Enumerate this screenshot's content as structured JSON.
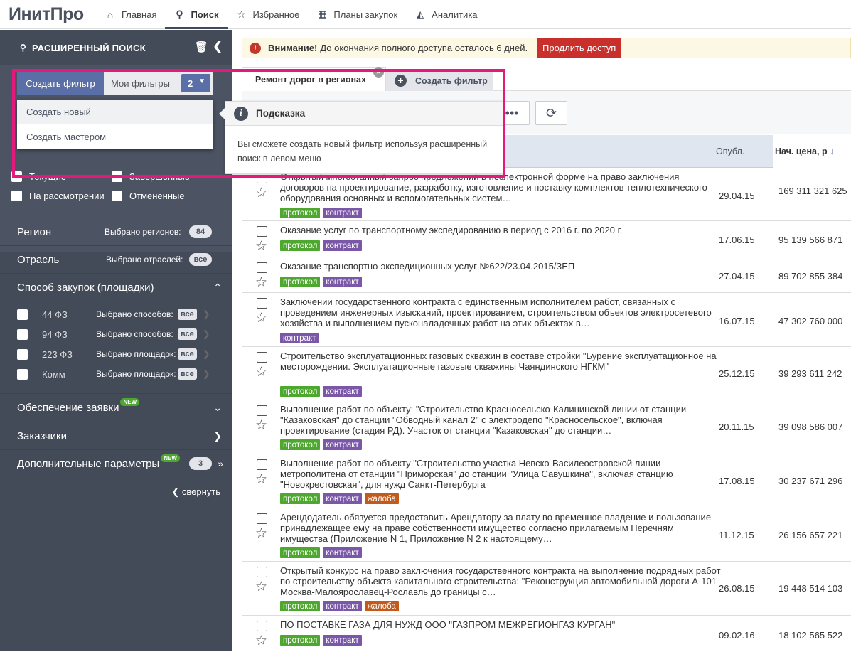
{
  "app": {
    "logo": "ИнитПро"
  },
  "nav": [
    {
      "label": "Главная",
      "icon": "home-icon",
      "glyph": "⌂"
    },
    {
      "label": "Поиск",
      "icon": "search-icon",
      "glyph": "⚲"
    },
    {
      "label": "Избранное",
      "icon": "star-icon",
      "glyph": "☆"
    },
    {
      "label": "Планы закупок",
      "icon": "calendar-icon",
      "glyph": "▦"
    },
    {
      "label": "Аналитика",
      "icon": "chart-icon",
      "glyph": "◭"
    }
  ],
  "sidebar": {
    "title": "РАСШИРЕННЫЙ ПОИСК",
    "filter_tabs": {
      "create": "Создать фильтр",
      "my": "Мои фильтры",
      "my_count": "2"
    },
    "dropdown": [
      "Создать новый",
      "Создать мастером"
    ],
    "status_checks": [
      "Текущие",
      "Завершенные",
      "На рассмотрении",
      "Отмененные"
    ],
    "region": {
      "label": "Регион",
      "meta": "Выбрано регионов:",
      "value": "84"
    },
    "industry": {
      "label": "Отрасль",
      "meta": "Выбрано отраслей:",
      "value": "все"
    },
    "method": {
      "label": "Способ закупок (площадки)"
    },
    "methods": [
      {
        "label": "44 ФЗ",
        "meta": "Выбрано способов:",
        "value": "все"
      },
      {
        "label": "94 ФЗ",
        "meta": "Выбрано способов:",
        "value": "все"
      },
      {
        "label": "223 ФЗ",
        "meta": "Выбрано площадок:",
        "value": "все"
      },
      {
        "label": "Комм",
        "meta": "Выбрано площадок:",
        "value": "все"
      }
    ],
    "security": {
      "label": "Обеспечение заявки",
      "badge": "NEW"
    },
    "customers": {
      "label": "Заказчики"
    },
    "extra": {
      "label": "Дополнительные параметры",
      "badge": "NEW",
      "count": "3"
    },
    "collapse": "свернуть"
  },
  "alert": {
    "strong": "Внимание!",
    "text": "До окончания полного доступа осталось 6 дней.",
    "button": "Продлить доступ"
  },
  "result_tabs": {
    "active": "Ремонт дорог в регионах",
    "add": "Создать фильтр"
  },
  "tooltip": {
    "title": "Подсказка",
    "body": "Вы сможете создать новый фильтр используя расширенный поиск в левом меню"
  },
  "table": {
    "headers": {
      "published": "Опубл.",
      "price": "Нач. цена, р"
    },
    "rows": [
      {
        "title": "Открытый многоэтапный запрос предложений в неэлектронной форме на право заключения договоров на проектирование, разработку, изготовление и поставку комплектов теплотехнического оборудования основных и вспомогательных систем…",
        "tags": [
          "протокол",
          "контракт"
        ],
        "date": "29.04.15",
        "price": "169 311 321 625"
      },
      {
        "title": "Оказание услуг по транспортному экспедированию в период с 2016 г. по 2020 г.",
        "tags": [
          "протокол",
          "контракт"
        ],
        "date": "17.06.15",
        "price": "95 139 566 871"
      },
      {
        "title": "Оказание транспортно-экспедиционных услуг №622/23.04.2015/ЗЕП",
        "tags": [
          "протокол",
          "контракт"
        ],
        "date": "27.04.15",
        "price": "89 702 855 384"
      },
      {
        "title": "Заключении государственного контракта с единственным исполнителем работ, связанных с проведением инженерных изысканий, проектированием, строительством объектов электросетевого хозяйства и выполнением пусконаладочных работ на этих объектах в…",
        "tags": [
          "контракт"
        ],
        "date": "16.07.15",
        "price": "47 302 760 000"
      },
      {
        "title": "Строительство эксплуатационных газовых скважин в составе стройки \"Бурение эксплуатационное на месторождении. Эксплуатационные газовые скважины Чаяндинского НГКМ\"",
        "tags": [
          "протокол",
          "контракт"
        ],
        "date": "25.12.15",
        "price": "39 293 611 242"
      },
      {
        "title": "Выполнение работ по объекту: \"Строительство Красносельско-Калининской линии от станции \"Казаковская\" до станции \"Обводный канал 2\" с электродепо \"Красносельское\", включая проектирование (стадия РД). Участок от станции \"Казаковская\" до станции…",
        "tags": [
          "протокол",
          "контракт"
        ],
        "date": "20.11.15",
        "price": "39 098 586 007"
      },
      {
        "title": "Выполнение работ по объекту \"Строительство участка Невско-Василеостровской линии метрополитена от станции \"Приморская\" до станции \"Улица Савушкина\", включая станцию \"Новокрестовская\", для нужд Санкт-Петербурга",
        "tags": [
          "протокол",
          "контракт",
          "жалоба"
        ],
        "date": "17.08.15",
        "price": "30 237 671 296"
      },
      {
        "title": "Арендодатель обязуется предоставить Арендатору за плату во временное владение и пользование принадлежащее ему на праве собственности имущество согласно прилагаемым Перечням имущества (Приложение N 1, Приложение N 2 к настоящему…",
        "tags": [
          "протокол",
          "контракт"
        ],
        "date": "11.12.15",
        "price": "26 156 657 221"
      },
      {
        "title": "Открытый конкурс на право заключения государственного контракта на выполнение подрядных работ по строительству объекта капитального строительства: \"Реконструкция автомобильной дороги А-101 Москва-Малоярославец-Рославль до границы с…",
        "tags": [
          "протокол",
          "контракт",
          "жалоба"
        ],
        "date": "26.08.15",
        "price": "19 448 514 103"
      },
      {
        "title": "ПО ПОСТАВКЕ ГАЗА ДЛЯ НУЖД ООО \"ГАЗПРОМ МЕЖРЕГИОНГАЗ КУРГАН\"",
        "tags": [
          "протокол",
          "контракт"
        ],
        "date": "09.02.16",
        "price": "18 102 565 522"
      }
    ]
  }
}
